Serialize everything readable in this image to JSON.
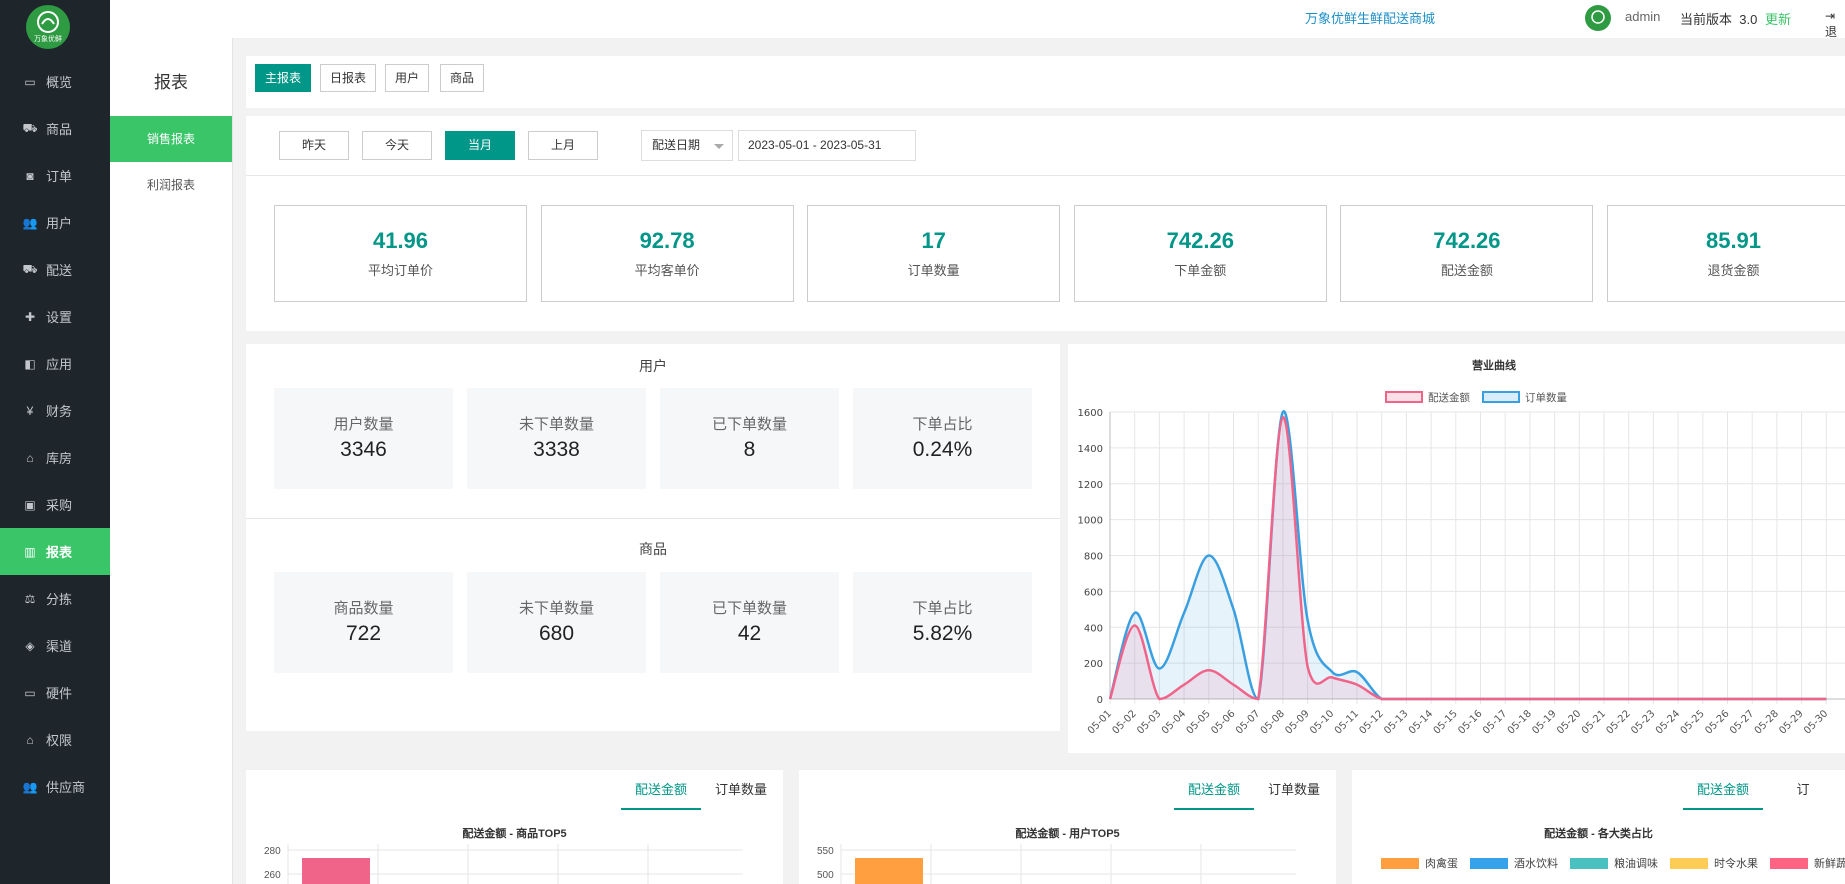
{
  "brand": {
    "logo_text": "万象优鲜",
    "logo_color": "#2e9a42"
  },
  "sidebar": {
    "items": [
      {
        "label": "概览",
        "icon": "monitor-icon"
      },
      {
        "label": "商品",
        "icon": "cart-icon"
      },
      {
        "label": "订单",
        "icon": "money-icon"
      },
      {
        "label": "用户",
        "icon": "users-icon"
      },
      {
        "label": "配送",
        "icon": "truck-icon"
      },
      {
        "label": "设置",
        "icon": "puzzle-icon"
      },
      {
        "label": "应用",
        "icon": "apps-icon"
      },
      {
        "label": "财务",
        "icon": "yen-icon"
      },
      {
        "label": "库房",
        "icon": "home-icon"
      },
      {
        "label": "采购",
        "icon": "train-icon"
      },
      {
        "label": "报表",
        "icon": "bar-chart-icon"
      },
      {
        "label": "分拣",
        "icon": "scale-icon"
      },
      {
        "label": "渠道",
        "icon": "cube-icon"
      },
      {
        "label": "硬件",
        "icon": "desktop-icon"
      },
      {
        "label": "权限",
        "icon": "bank-icon"
      },
      {
        "label": "供应商",
        "icon": "users-icon"
      }
    ],
    "active_index": 10
  },
  "header": {
    "shop_name": "万象优鲜生鲜配送商城",
    "username": "admin",
    "version_label": "当前版本",
    "version": "3.0",
    "update_label": "更新",
    "logout_label": "退"
  },
  "subnav": {
    "title": "报表",
    "items": [
      "销售报表",
      "利润报表"
    ],
    "active_index": 0
  },
  "report_tabs": [
    "主报表",
    "日报表",
    "用户",
    "商品"
  ],
  "filter": {
    "quick": [
      "昨天",
      "今天",
      "当月",
      "上月"
    ],
    "active": 2,
    "date_type": "配送日期",
    "date_range": "2023-05-01 - 2023-05-31"
  },
  "summary": [
    {
      "value": "41.96",
      "label": "平均订单价"
    },
    {
      "value": "92.78",
      "label": "平均客单价"
    },
    {
      "value": "17",
      "label": "订单数量"
    },
    {
      "value": "742.26",
      "label": "下单金额"
    },
    {
      "value": "742.26",
      "label": "配送金额"
    },
    {
      "value": "85.91",
      "label": "退货金额"
    }
  ],
  "users": {
    "title": "用户",
    "stats": [
      {
        "label": "用户数量",
        "value": "3346"
      },
      {
        "label": "未下单数量",
        "value": "3338"
      },
      {
        "label": "已下单数量",
        "value": "8"
      },
      {
        "label": "下单占比",
        "value": "0.24%"
      }
    ]
  },
  "goods": {
    "title": "商品",
    "stats": [
      {
        "label": "商品数量",
        "value": "722"
      },
      {
        "label": "未下单数量",
        "value": "680"
      },
      {
        "label": "已下单数量",
        "value": "42"
      },
      {
        "label": "下单占比",
        "value": "5.82%"
      }
    ]
  },
  "chart_data": [
    {
      "type": "line",
      "title": "营业曲线",
      "categories": [
        "05-01",
        "05-02",
        "05-03",
        "05-04",
        "05-05",
        "05-06",
        "05-07",
        "05-08",
        "05-09",
        "05-10",
        "05-11",
        "05-12",
        "05-13",
        "05-14",
        "05-15",
        "05-16",
        "05-17",
        "05-18",
        "05-19",
        "05-20",
        "05-21",
        "05-22",
        "05-23",
        "05-24",
        "05-25",
        "05-26",
        "05-27",
        "05-28",
        "05-29",
        "05-30"
      ],
      "series": [
        {
          "name": "配送金额",
          "color": "#f0648a",
          "values": [
            0,
            410,
            0,
            80,
            160,
            80,
            0,
            1570,
            180,
            120,
            80,
            0,
            0,
            0,
            0,
            0,
            0,
            0,
            0,
            0,
            0,
            0,
            0,
            0,
            0,
            0,
            0,
            0,
            0,
            0
          ]
        },
        {
          "name": "订单数量",
          "color": "#3a9fe0",
          "values": [
            0,
            480,
            170,
            480,
            800,
            500,
            0,
            1600,
            440,
            150,
            150,
            0,
            0,
            0,
            0,
            0,
            0,
            0,
            0,
            0,
            0,
            0,
            0,
            0,
            0,
            0,
            0,
            0,
            0,
            0
          ]
        }
      ],
      "ylim": [
        0,
        1600
      ],
      "yticks": [
        0,
        200,
        400,
        600,
        800,
        1000,
        1200,
        1400,
        1600
      ],
      "grid": true,
      "legend": "top-center"
    }
  ],
  "bottom_panels": [
    {
      "tabs": [
        "配送金额",
        "订单数量"
      ],
      "title": "配送金额 - 商品TOP5",
      "yticks": [
        "280",
        "260"
      ],
      "bar_color": "#f0648a"
    },
    {
      "tabs": [
        "配送金额",
        "订单数量"
      ],
      "title": "配送金额 - 用户TOP5",
      "yticks": [
        "550",
        "500"
      ],
      "bar_color": "#ff9f40"
    },
    {
      "tabs": [
        "配送金额",
        "订"
      ],
      "title": "配送金额 - 各大类占比",
      "legend": [
        {
          "name": "肉禽蛋",
          "color": "#ff9f40"
        },
        {
          "name": "酒水饮料",
          "color": "#36a2eb"
        },
        {
          "name": "粮油调味",
          "color": "#4bc0c0"
        },
        {
          "name": "时令水果",
          "color": "#ffcd56"
        },
        {
          "name": "新鲜蔬",
          "color": "#ff6384"
        }
      ]
    }
  ]
}
